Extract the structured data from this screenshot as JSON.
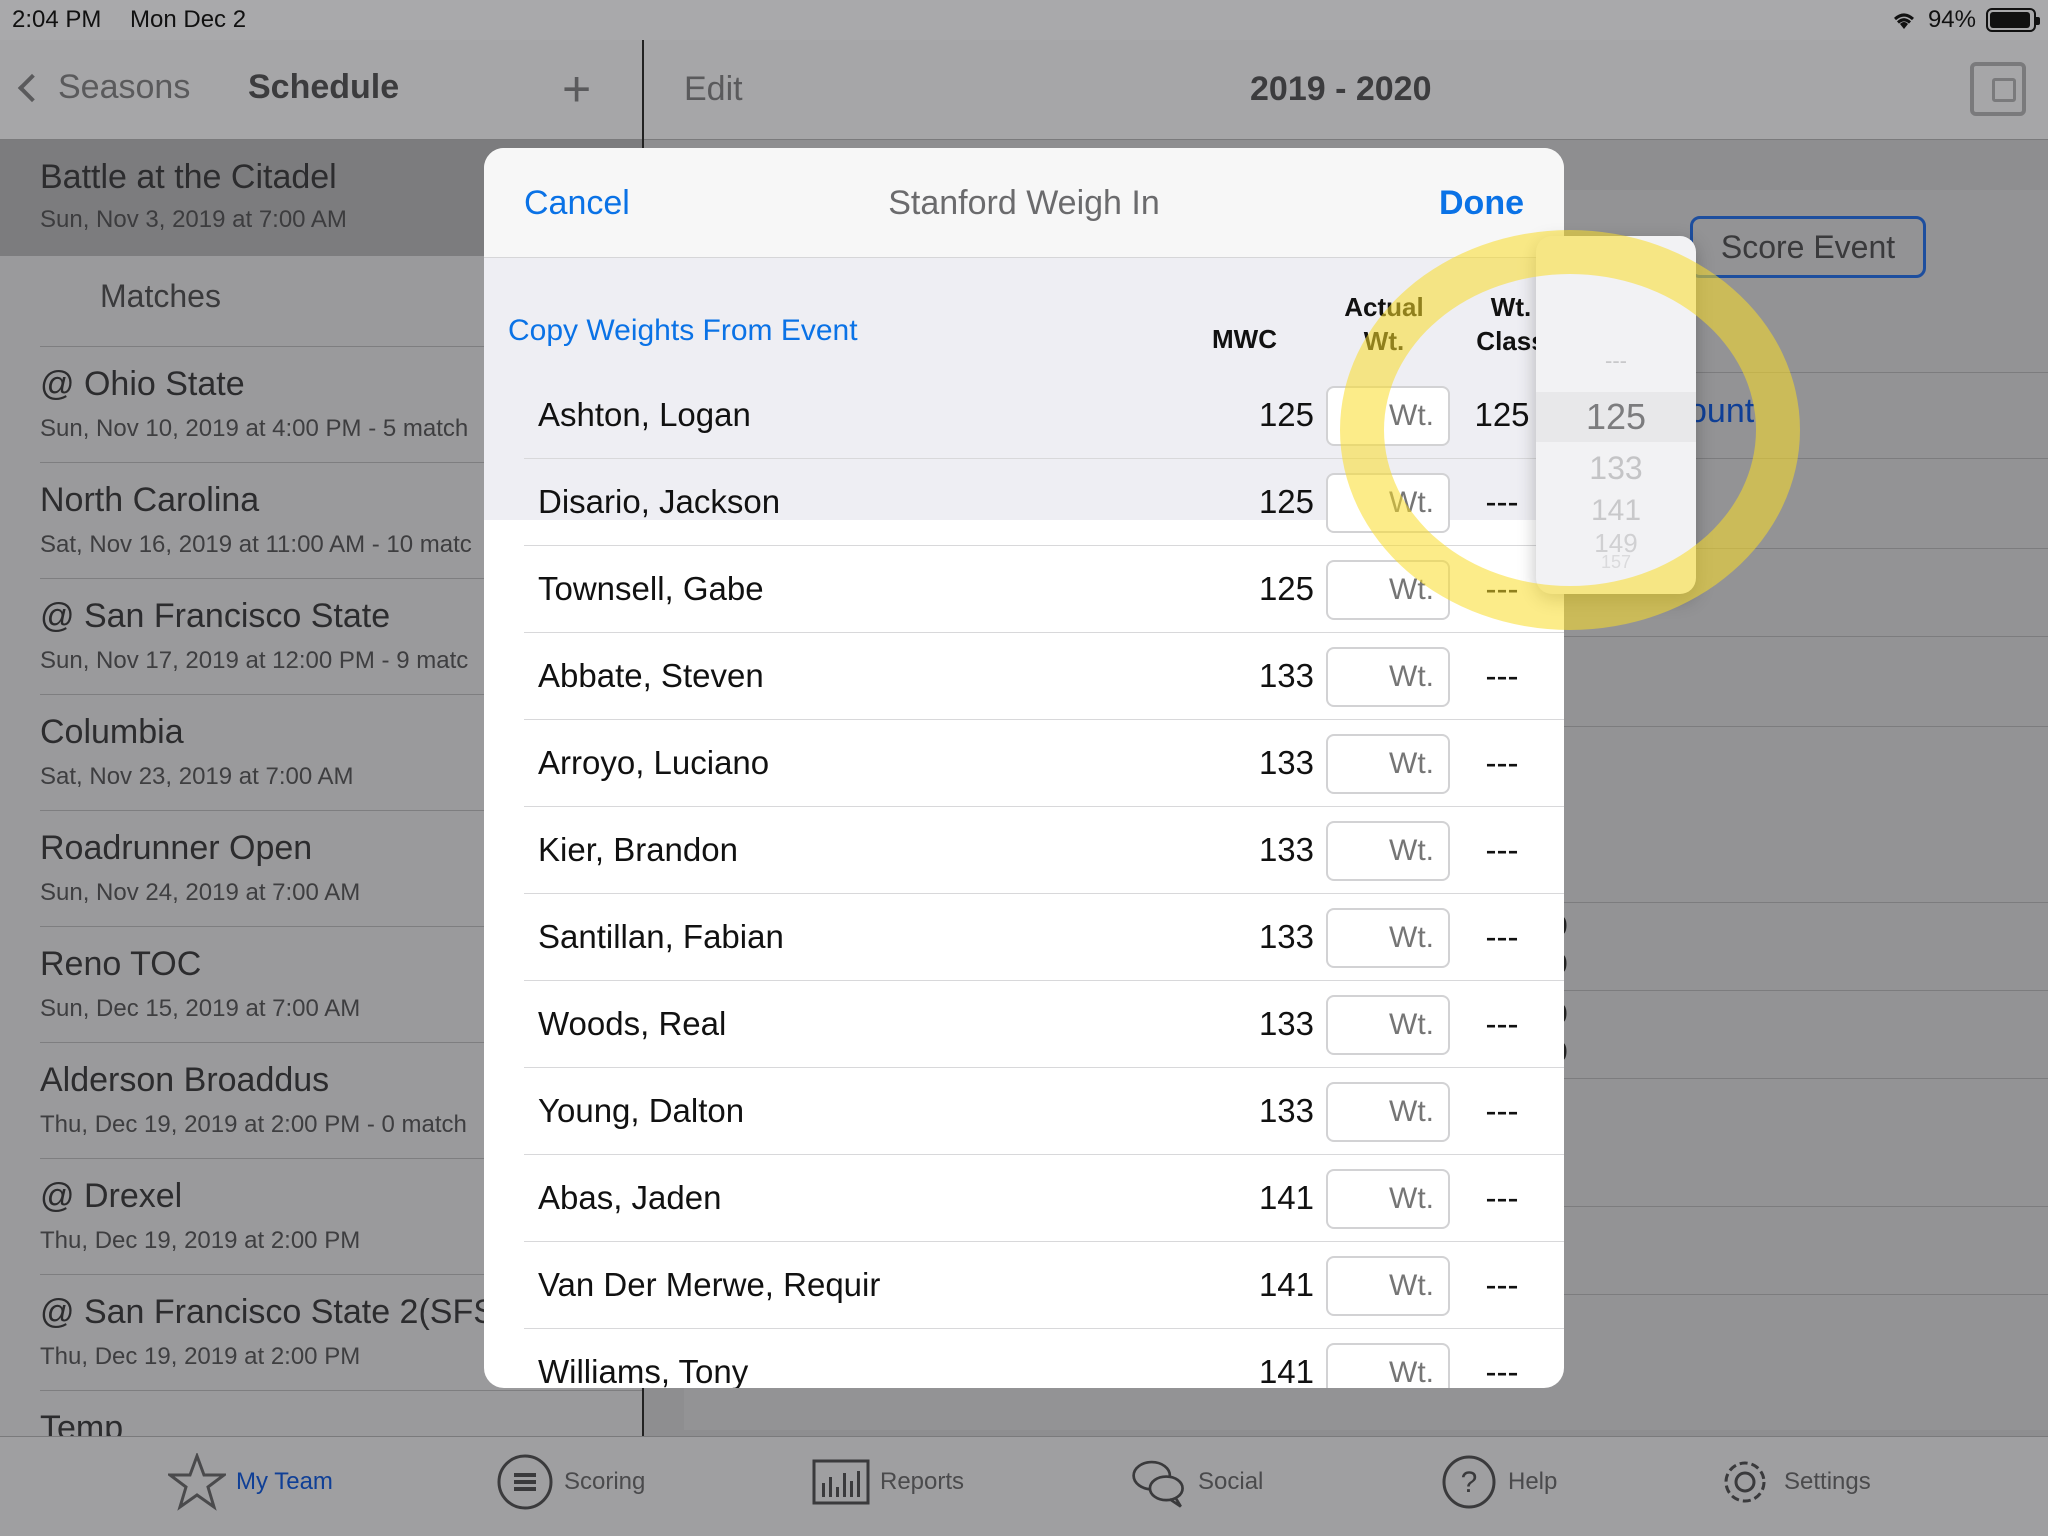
{
  "status_bar": {
    "time": "2:04 PM",
    "date": "Mon Dec 2",
    "battery": "94%"
  },
  "left_nav": {
    "back_label": "Seasons",
    "title": "Schedule",
    "add_label": "+"
  },
  "selected_event": {
    "title": "Battle at the Citadel",
    "subtitle": "Sun, Nov 3, 2019 at 7:00 AM"
  },
  "matches_label": "Matches",
  "events": [
    {
      "title": "@ Ohio State",
      "subtitle": "Sun, Nov 10, 2019 at 4:00 PM - 5 match"
    },
    {
      "title": "North Carolina",
      "subtitle": "Sat, Nov 16, 2019 at 11:00 AM - 10 matc"
    },
    {
      "title": "@ San Francisco State",
      "subtitle": "Sun, Nov 17, 2019 at 12:00 PM - 9 matc"
    },
    {
      "title": "Columbia",
      "subtitle": "Sat, Nov 23, 2019 at 7:00 AM"
    },
    {
      "title": "Roadrunner Open",
      "subtitle": "Sun, Nov 24, 2019 at 7:00 AM"
    },
    {
      "title": "Reno TOC",
      "subtitle": "Sun, Dec 15, 2019 at 7:00 AM"
    },
    {
      "title": "Alderson Broaddus",
      "subtitle": "Thu, Dec 19, 2019 at 2:00 PM - 0 match"
    },
    {
      "title": "@ Drexel",
      "subtitle": "Thu, Dec 19, 2019 at 2:00 PM"
    },
    {
      "title": "@ San Francisco State 2(SFS",
      "subtitle": "Thu, Dec 19, 2019 at 2:00 PM"
    },
    {
      "title": "Temp",
      "subtitle": ""
    }
  ],
  "right_nav": {
    "edit_label": "Edit",
    "title": "2019 - 2020"
  },
  "score_event_label": "Score Event",
  "partial_text": "ount",
  "partial_digits": [
    "0",
    "0",
    "0",
    "0"
  ],
  "modal": {
    "cancel_label": "Cancel",
    "title": "Stanford Weigh In",
    "done_label": "Done",
    "copy_label": "Copy Weights From Event",
    "col_mwc": "MWC",
    "col_actual_1": "Actual",
    "col_actual_2": "Wt.",
    "col_class_1": "Wt.",
    "col_class_2": "Class",
    "wt_placeholder": "Wt.",
    "rows": [
      {
        "name": "Ashton, Logan",
        "mwc": "125",
        "cls": "125"
      },
      {
        "name": "Disario, Jackson",
        "mwc": "125",
        "cls": "---"
      },
      {
        "name": "Townsell, Gabe",
        "mwc": "125",
        "cls": "---"
      },
      {
        "name": "Abbate, Steven",
        "mwc": "133",
        "cls": "---"
      },
      {
        "name": "Arroyo, Luciano",
        "mwc": "133",
        "cls": "---"
      },
      {
        "name": "Kier, Brandon",
        "mwc": "133",
        "cls": "---"
      },
      {
        "name": "Santillan, Fabian",
        "mwc": "133",
        "cls": "---"
      },
      {
        "name": "Woods, Real",
        "mwc": "133",
        "cls": "---"
      },
      {
        "name": "Young, Dalton",
        "mwc": "133",
        "cls": "---"
      },
      {
        "name": "Abas, Jaden",
        "mwc": "141",
        "cls": "---"
      },
      {
        "name": "Van Der Merwe, Requir",
        "mwc": "141",
        "cls": "---"
      },
      {
        "name": "Williams, Tony",
        "mwc": "141",
        "cls": "---"
      }
    ]
  },
  "picker": {
    "options": [
      "---",
      "125",
      "133",
      "141",
      "149",
      "157"
    ],
    "selected": "125"
  },
  "tabs": [
    {
      "label": "My Team",
      "icon": "star-icon",
      "active": true
    },
    {
      "label": "Scoring",
      "icon": "scoring-icon",
      "active": false
    },
    {
      "label": "Reports",
      "icon": "reports-icon",
      "active": false
    },
    {
      "label": "Social",
      "icon": "chat-icon",
      "active": false
    },
    {
      "label": "Help",
      "icon": "help-icon",
      "active": false
    },
    {
      "label": "Settings",
      "icon": "gear-icon",
      "active": false
    }
  ],
  "colors": {
    "accent": "#0a72e6",
    "highlight": "#fadc28"
  }
}
